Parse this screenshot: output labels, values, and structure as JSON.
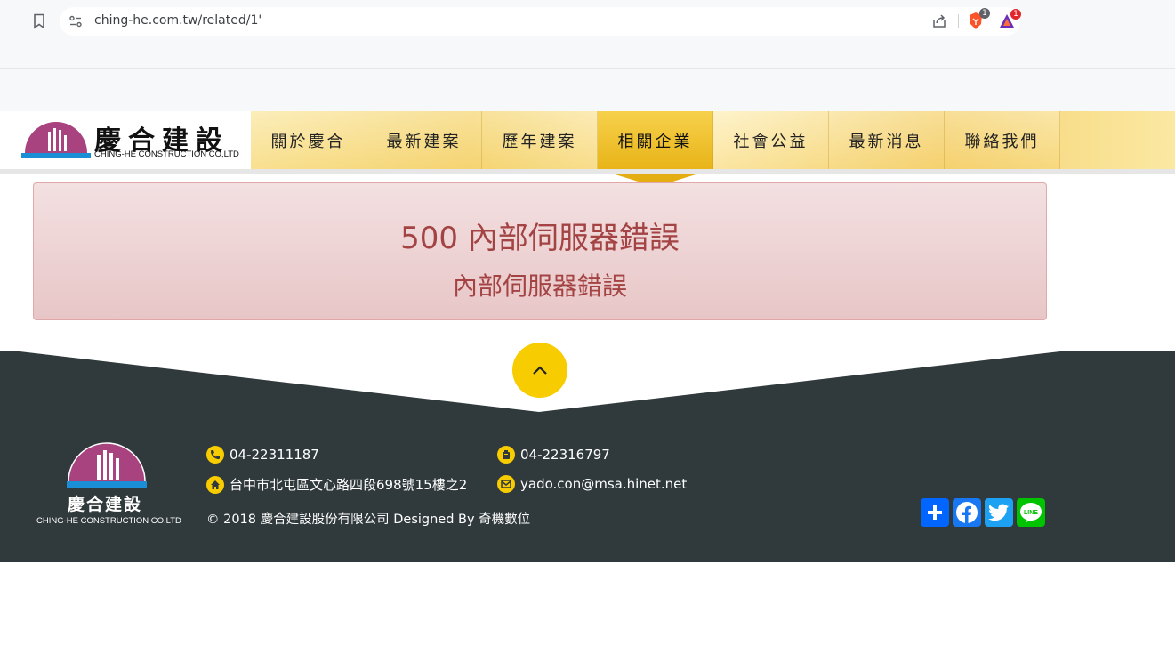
{
  "browser": {
    "url": "ching-he.com.tw/related/1'",
    "brave_badge": "1",
    "rewards_badge": "1"
  },
  "site": {
    "logo_cn": "慶合建設",
    "logo_en": "CHING-HE CONSTRUCTION CO,LTD",
    "nav": [
      "關於慶合",
      "最新建案",
      "歷年建案",
      "相關企業",
      "社會公益",
      "最新消息",
      "聯絡我們"
    ],
    "active_nav": "相關企業"
  },
  "error": {
    "title": "500 內部伺服器錯誤",
    "message": "內部伺服器錯誤"
  },
  "footer": {
    "logo_cn": "慶合建設",
    "logo_en": "CHING-HE CONSTRUCTION CO,LTD",
    "phone": "04-22311187",
    "fax": "04-22316797",
    "address": "台中市北屯區文心路四段698號15樓之2",
    "email": "yado.con@msa.hinet.net",
    "copyright": "© 2018 慶合建設股份有限公司 Designed By 奇機數位",
    "social": [
      "share",
      "facebook",
      "twitter",
      "line"
    ]
  },
  "colors": {
    "accent": "#f7cc00",
    "footer_bg": "#30393b",
    "error_text": "#a44343",
    "facebook": "#1877f2",
    "twitter": "#1da1f2",
    "line": "#00c300",
    "share": "#0166ff"
  }
}
